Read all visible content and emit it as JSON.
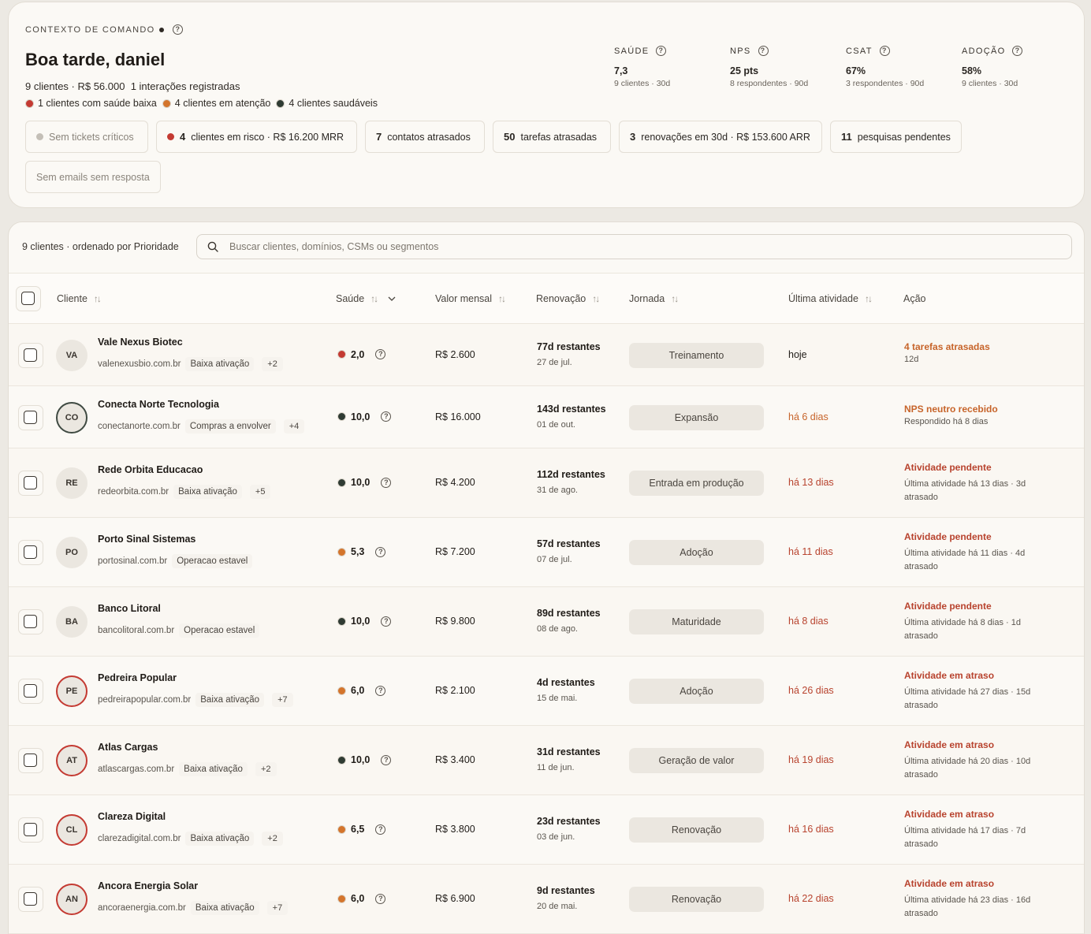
{
  "header": {
    "context_label": "CONTEXTO DE COMANDO",
    "greeting": "Boa tarde, daniel",
    "summary_clients": "9 clientes · R$ 56.000",
    "summary_interactions": "1 interações registradas",
    "legend": [
      {
        "label": "1 clientes com saúde baixa",
        "color": "#c43a32"
      },
      {
        "label": "4 clientes em atenção",
        "color": "#d4752c"
      },
      {
        "label": "4 clientes saudáveis",
        "color": "#2f3b33"
      }
    ]
  },
  "metrics": [
    {
      "label": "SAÚDE",
      "value": "7,3",
      "sub": "9 clientes · 30d"
    },
    {
      "label": "NPS",
      "value": "25 pts",
      "sub": "8 respondentes · 90d"
    },
    {
      "label": "CSAT",
      "value": "67%",
      "sub": "3 respondentes · 90d"
    },
    {
      "label": "ADOÇÃO",
      "value": "58%",
      "sub": "9 clientes · 30d"
    }
  ],
  "chips": {
    "no_critical": "Sem tickets críticos",
    "risk_count": "4",
    "risk_label": "clientes em risco · R$ 16.200 MRR",
    "contacts_count": "7",
    "contacts_label": "contatos atrasados",
    "tasks_count": "50",
    "tasks_label": "tarefas atrasadas",
    "renewals_count": "3",
    "renewals_label": "renovações em 30d · R$ 153.600 ARR",
    "surveys_count": "11",
    "surveys_label": "pesquisas pendentes",
    "no_emails": "Sem emails sem resposta"
  },
  "list": {
    "count_label": "9 clientes · ordenado por Prioridade",
    "search_placeholder": "Buscar clientes, domínios, CSMs ou segmentos",
    "columns": {
      "client": "Cliente",
      "health": "Saúde",
      "mrr": "Valor mensal",
      "renewal": "Renovação",
      "journey": "Jornada",
      "last_activity": "Última atividade",
      "action": "Ação"
    }
  },
  "colors": {
    "red": "#c43a32",
    "orange": "#d4752c",
    "green": "#2f3b33",
    "action_orange": "#c7642a",
    "action_red": "#b8432e"
  },
  "rows": [
    {
      "initials": "VA",
      "ring": "none",
      "name": "Vale Nexus Biotec",
      "domain": "valenexusbio.com.br",
      "tag": "Baixa ativação",
      "extra": "+2",
      "health": "2,0",
      "health_color": "red",
      "mrr": "R$ 2.600",
      "renewal_days": "77d restantes",
      "renewal_date": "27 de jul.",
      "journey": "Treinamento",
      "last": "hoje",
      "last_style": "plain",
      "action_title": "4 tarefas atrasadas",
      "action_style": "orange",
      "action_sub": "12d"
    },
    {
      "initials": "CO",
      "ring": "dark",
      "name": "Conecta Norte Tecnologia",
      "domain": "conectanorte.com.br",
      "tag": "Compras a envolver",
      "extra": "+4",
      "health": "10,0",
      "health_color": "green",
      "mrr": "R$ 16.000",
      "renewal_days": "143d restantes",
      "renewal_date": "01 de out.",
      "journey": "Expansão",
      "last": "há 6 dias",
      "last_style": "orange",
      "action_title": "NPS neutro recebido",
      "action_style": "orange",
      "action_sub": "Respondido há 8 dias"
    },
    {
      "initials": "RE",
      "ring": "none",
      "name": "Rede Orbita Educacao",
      "domain": "redeorbita.com.br",
      "tag": "Baixa ativação",
      "extra": "+5",
      "health": "10,0",
      "health_color": "green",
      "mrr": "R$ 4.200",
      "renewal_days": "112d restantes",
      "renewal_date": "31 de ago.",
      "journey": "Entrada em produção",
      "last": "há 13 dias",
      "last_style": "red",
      "action_title": "Atividade pendente",
      "action_style": "red",
      "action_sub": "Última atividade há 13 dias · 3d atrasado"
    },
    {
      "initials": "PO",
      "ring": "none",
      "name": "Porto Sinal Sistemas",
      "domain": "portosinal.com.br",
      "tag": "Operacao estavel",
      "extra": "",
      "health": "5,3",
      "health_color": "orange",
      "mrr": "R$ 7.200",
      "renewal_days": "57d restantes",
      "renewal_date": "07 de jul.",
      "journey": "Adoção",
      "last": "há 11 dias",
      "last_style": "red",
      "action_title": "Atividade pendente",
      "action_style": "red",
      "action_sub": "Última atividade há 11 dias · 4d atrasado"
    },
    {
      "initials": "BA",
      "ring": "none",
      "name": "Banco Litoral",
      "domain": "bancolitoral.com.br",
      "tag": "Operacao estavel",
      "extra": "",
      "health": "10,0",
      "health_color": "green",
      "mrr": "R$ 9.800",
      "renewal_days": "89d restantes",
      "renewal_date": "08 de ago.",
      "journey": "Maturidade",
      "last": "há 8 dias",
      "last_style": "red",
      "action_title": "Atividade pendente",
      "action_style": "red",
      "action_sub": "Última atividade há 8 dias · 1d atrasado"
    },
    {
      "initials": "PE",
      "ring": "red",
      "name": "Pedreira Popular",
      "domain": "pedreirapopular.com.br",
      "tag": "Baixa ativação",
      "extra": "+7",
      "health": "6,0",
      "health_color": "orange",
      "mrr": "R$ 2.100",
      "renewal_days": "4d restantes",
      "renewal_date": "15 de mai.",
      "journey": "Adoção",
      "last": "há 26 dias",
      "last_style": "red",
      "action_title": "Atividade em atraso",
      "action_style": "red",
      "action_sub": "Última atividade há 27 dias · 15d atrasado"
    },
    {
      "initials": "AT",
      "ring": "red",
      "name": "Atlas Cargas",
      "domain": "atlascargas.com.br",
      "tag": "Baixa ativação",
      "extra": "+2",
      "health": "10,0",
      "health_color": "green",
      "mrr": "R$ 3.400",
      "renewal_days": "31d restantes",
      "renewal_date": "11 de jun.",
      "journey": "Geração de valor",
      "last": "há 19 dias",
      "last_style": "red",
      "action_title": "Atividade em atraso",
      "action_style": "red",
      "action_sub": "Última atividade há 20 dias · 10d atrasado"
    },
    {
      "initials": "CL",
      "ring": "red",
      "name": "Clareza Digital",
      "domain": "clarezadigital.com.br",
      "tag": "Baixa ativação",
      "extra": "+2",
      "health": "6,5",
      "health_color": "orange",
      "mrr": "R$ 3.800",
      "renewal_days": "23d restantes",
      "renewal_date": "03 de jun.",
      "journey": "Renovação",
      "last": "há 16 dias",
      "last_style": "red",
      "action_title": "Atividade em atraso",
      "action_style": "red",
      "action_sub": "Última atividade há 17 dias · 7d atrasado"
    },
    {
      "initials": "AN",
      "ring": "red",
      "name": "Ancora Energia Solar",
      "domain": "ancoraenergia.com.br",
      "tag": "Baixa ativação",
      "extra": "+7",
      "health": "6,0",
      "health_color": "orange",
      "mrr": "R$ 6.900",
      "renewal_days": "9d restantes",
      "renewal_date": "20 de mai.",
      "journey": "Renovação",
      "last": "há 22 dias",
      "last_style": "red",
      "action_title": "Atividade em atraso",
      "action_style": "red",
      "action_sub": "Última atividade há 23 dias · 16d atrasado"
    }
  ]
}
